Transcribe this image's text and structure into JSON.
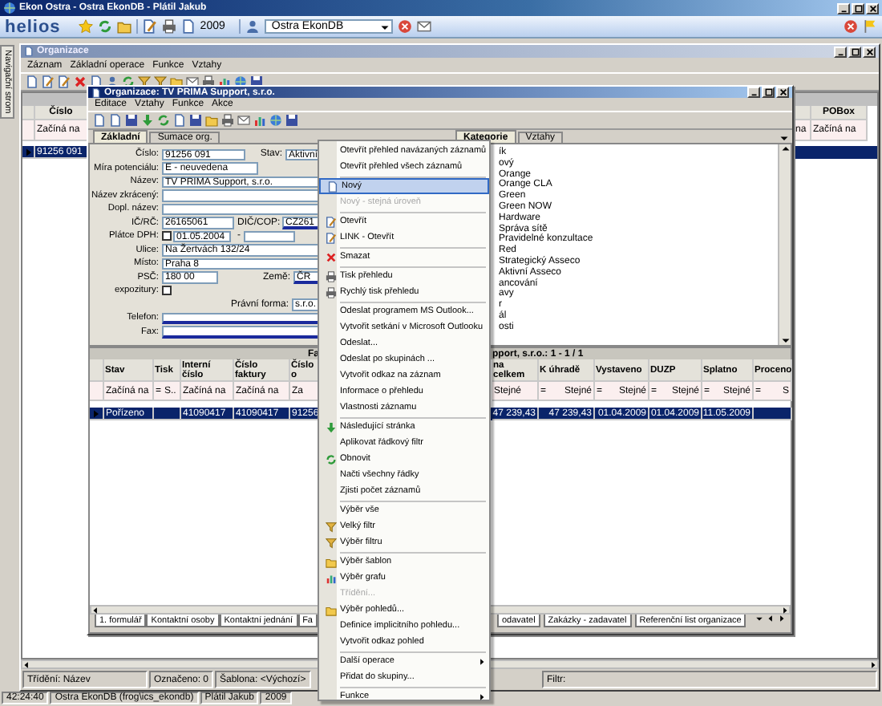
{
  "app": {
    "title": "Ekon Ostra - Ostra EkonDB - Plátil Jakub",
    "logo": "helios",
    "year": "2009",
    "database": "Ostra EkonDB",
    "status": [
      "42:24:40",
      "Ostra EkonDB (frog\\ics_ekondb)",
      "Plátil Jakub",
      "2009"
    ]
  },
  "nav_tab": {
    "label": "Navigační strom"
  },
  "list_window": {
    "title": "Organizace",
    "menu": [
      "Záznam",
      "Základní operace",
      "Funkce",
      "Vztahy"
    ],
    "columns": [
      {
        "label": "Číslo",
        "filter": "Začíná na"
      },
      {
        "filter": "na"
      },
      {
        "label": "POBox",
        "filter": "Začíná na"
      }
    ],
    "rows": [
      {
        "selected": true,
        "cells": [
          "91256 091"
        ]
      }
    ],
    "status": [
      "Třídění: Název",
      "Označeno: 0",
      "Šablona: <Výchozí>",
      "Filtr:"
    ]
  },
  "detail_window": {
    "title": "Organizace: TV PRIMA Support, s.r.o.",
    "menu": [
      "Editace",
      "Vztahy",
      "Funkce",
      "Akce"
    ],
    "tabs": [
      {
        "label": "Základní",
        "selected": true
      },
      {
        "label": "Sumace org.",
        "selected": false
      }
    ],
    "form": [
      {
        "label": "Číslo:",
        "fields": [
          {
            "kind": "text",
            "value": "91256 091",
            "required": false
          },
          {
            "kind": "label",
            "text": "Stav:"
          },
          {
            "kind": "text",
            "value": "Aktivní",
            "required": false
          }
        ]
      },
      {
        "label": "Míra potenciálu:",
        "fields": [
          {
            "kind": "text",
            "value": "E - neuvedena",
            "required": false
          }
        ]
      },
      {
        "label": "Název:",
        "fields": [
          {
            "kind": "text",
            "value": "TV PRIMA Support, s.r.o.",
            "required": false
          }
        ]
      },
      {
        "label": "Název zkrácený:",
        "fields": [
          {
            "kind": "text",
            "required": false
          }
        ]
      },
      {
        "label": "Dopl. název:",
        "fields": [
          {
            "kind": "text",
            "required": false
          }
        ]
      },
      {
        "label": "IČ/RČ:",
        "fields": [
          {
            "kind": "text",
            "value": "26165061",
            "required": false
          },
          {
            "kind": "label",
            "text": "DIČ/COP:"
          },
          {
            "kind": "text",
            "value": "CZ261",
            "required": true
          }
        ]
      },
      {
        "label": "Plátce DPH:",
        "fields": [
          {
            "kind": "check",
            "checked": false
          },
          {
            "kind": "text",
            "value": "01.05.2004",
            "required": false
          },
          {
            "kind": "label",
            "text": "-"
          },
          {
            "kind": "text",
            "required": false
          }
        ]
      },
      {
        "label": "Ulice:",
        "fields": [
          {
            "kind": "text",
            "value": "Na Žertvách 132/24",
            "required": false
          }
        ]
      },
      {
        "label": "Místo:",
        "fields": [
          {
            "kind": "text",
            "value": "Praha 8",
            "required": false
          }
        ]
      },
      {
        "label": "PSČ:",
        "fields": [
          {
            "kind": "text",
            "value": "180 00",
            "required": false
          },
          {
            "kind": "label",
            "text": "Země:"
          },
          {
            "kind": "text",
            "value": "ČR",
            "required": true
          }
        ]
      },
      {
        "label": "expozitury:",
        "fields": [
          {
            "kind": "check",
            "checked": false
          }
        ]
      },
      {
        "fields": [
          {
            "kind": "label",
            "text": "Právní forma:"
          },
          {
            "kind": "text",
            "value": "s.r.o.",
            "required": false
          }
        ]
      },
      {
        "label": "Telefon:",
        "fields": [
          {
            "kind": "text",
            "required": true
          }
        ]
      },
      {
        "label": "Fax:",
        "fields": [
          {
            "kind": "text",
            "required": true
          }
        ]
      }
    ],
    "category_tabs": [
      {
        "label": "Kategorie",
        "selected": true
      },
      {
        "label": "Vztahy",
        "selected": false
      }
    ],
    "categories": [
      "ík",
      "ový",
      "Orange",
      "Orange CLA",
      "Green",
      "Green NOW",
      "Hardware",
      "Správa sítě",
      "Pravidelné konzultace",
      "Red",
      "Strategický Asseco",
      "Aktivní Asseco",
      "ancování",
      "avy",
      "r",
      "ál",
      "osti"
    ],
    "grid": {
      "title_start": "Fa",
      "title_end": "pport, s.r.o.: 1 - 1 / 1",
      "columns": [
        {
          "label": "Stav",
          "filter": "Začíná na"
        },
        {
          "label": "Tisk",
          "op": "=",
          "filter": "S.."
        },
        {
          "label": "Interní číslo",
          "filter": "Začíná na"
        },
        {
          "label": "Číslo faktury",
          "filter": "Začíná na"
        },
        {
          "label": "Číslo o",
          "filter": "Za"
        },
        {
          "label": "na celkem",
          "filter": "Stejné"
        },
        {
          "label": "K úhradě",
          "op": "=",
          "filter": "Stejné"
        },
        {
          "label": "Vystaveno",
          "op": "=",
          "filter": "Stejné"
        },
        {
          "label": "DUZP",
          "op": "=",
          "filter": "Stejné"
        },
        {
          "label": "Splatno",
          "op": "=",
          "filter": "Stejné"
        },
        {
          "label": "Proceno",
          "op": "=",
          "filter": "S"
        }
      ],
      "rows": [
        {
          "selected": true,
          "cells": [
            "Pořízeno",
            null,
            "41090417",
            "41090417",
            "91256",
            "47 239,43",
            "47 239,43",
            "01.04.2009",
            "01.04.2009",
            "11.05.2009",
            null
          ]
        }
      ]
    },
    "bottom_tabs": [
      "1. formulář",
      "Kontaktní osoby",
      "Kontaktní jednání",
      "Fa",
      "odavatel",
      "Zakázky - zadavatel",
      "Referenční list organizace"
    ]
  },
  "context_menu": {
    "groups": [
      [
        {
          "label": "Otevřít přehled navázaných záznamů",
          "selected": false,
          "disabled": false,
          "submenu": false
        },
        {
          "label": "Otevřít přehled všech záznamů",
          "selected": false,
          "disabled": false,
          "submenu": false
        }
      ],
      [
        {
          "label": "Nový",
          "selected": true,
          "disabled": false,
          "submenu": false
        },
        {
          "label": "Nový - stejná úroveň",
          "selected": false,
          "disabled": true,
          "submenu": false
        }
      ],
      [
        {
          "label": "Otevřít",
          "selected": false,
          "disabled": false,
          "submenu": false
        },
        {
          "label": "LINK - Otevřít",
          "selected": false,
          "disabled": false,
          "submenu": false
        }
      ],
      [
        {
          "label": "Smazat",
          "selected": false,
          "disabled": false,
          "submenu": false
        }
      ],
      [
        {
          "label": "Tisk přehledu",
          "selected": false,
          "disabled": false,
          "submenu": false
        },
        {
          "label": "Rychlý tisk přehledu",
          "selected": false,
          "disabled": false,
          "submenu": false
        }
      ],
      [
        {
          "label": "Odeslat programem MS Outlook...",
          "selected": false,
          "disabled": false,
          "submenu": false
        },
        {
          "label": "Vytvořit setkání v Microsoft Outlooku",
          "selected": false,
          "disabled": false,
          "submenu": false
        },
        {
          "label": "Odeslat...",
          "selected": false,
          "disabled": false,
          "submenu": false
        },
        {
          "label": "Odeslat po skupinách ...",
          "selected": false,
          "disabled": false,
          "submenu": false
        },
        {
          "label": "Vytvořit odkaz na záznam",
          "selected": false,
          "disabled": false,
          "submenu": false
        },
        {
          "label": "Informace o přehledu",
          "selected": false,
          "disabled": false,
          "submenu": false
        },
        {
          "label": "Vlastnosti záznamu",
          "selected": false,
          "disabled": false,
          "submenu": false
        }
      ],
      [
        {
          "label": "Následující stránka",
          "selected": false,
          "disabled": false,
          "submenu": false
        },
        {
          "label": "Aplikovat řádkový filtr",
          "selected": false,
          "disabled": false,
          "submenu": false
        },
        {
          "label": "Obnovit",
          "selected": false,
          "disabled": false,
          "submenu": false
        },
        {
          "label": "Načti všechny řádky",
          "selected": false,
          "disabled": false,
          "submenu": false
        },
        {
          "label": "Zjisti počet záznamů",
          "selected": false,
          "disabled": false,
          "submenu": false
        }
      ],
      [
        {
          "label": "Výběr vše",
          "selected": false,
          "disabled": false,
          "submenu": false
        },
        {
          "label": "Velký filtr",
          "selected": false,
          "disabled": false,
          "submenu": false
        },
        {
          "label": "Výběr filtru",
          "selected": false,
          "disabled": false,
          "submenu": false
        }
      ],
      [
        {
          "label": "Výběr šablon",
          "selected": false,
          "disabled": false,
          "submenu": false
        },
        {
          "label": "Výběr grafu",
          "selected": false,
          "disabled": false,
          "submenu": false
        },
        {
          "label": "Třídění...",
          "selected": false,
          "disabled": true,
          "submenu": false
        },
        {
          "label": "Výběr pohledů...",
          "selected": false,
          "disabled": false,
          "submenu": false
        },
        {
          "label": "Definice implicitního pohledu...",
          "selected": false,
          "disabled": false,
          "submenu": false
        },
        {
          "label": "Vytvořit odkaz pohled",
          "selected": false,
          "disabled": false,
          "submenu": false
        }
      ],
      [
        {
          "label": "Další operace",
          "selected": false,
          "disabled": false,
          "submenu": true
        },
        {
          "label": "Přidat do skupiny...",
          "selected": false,
          "disabled": false,
          "submenu": false
        }
      ],
      [
        {
          "label": "Funkce",
          "selected": false,
          "disabled": false,
          "submenu": true
        }
      ]
    ]
  }
}
